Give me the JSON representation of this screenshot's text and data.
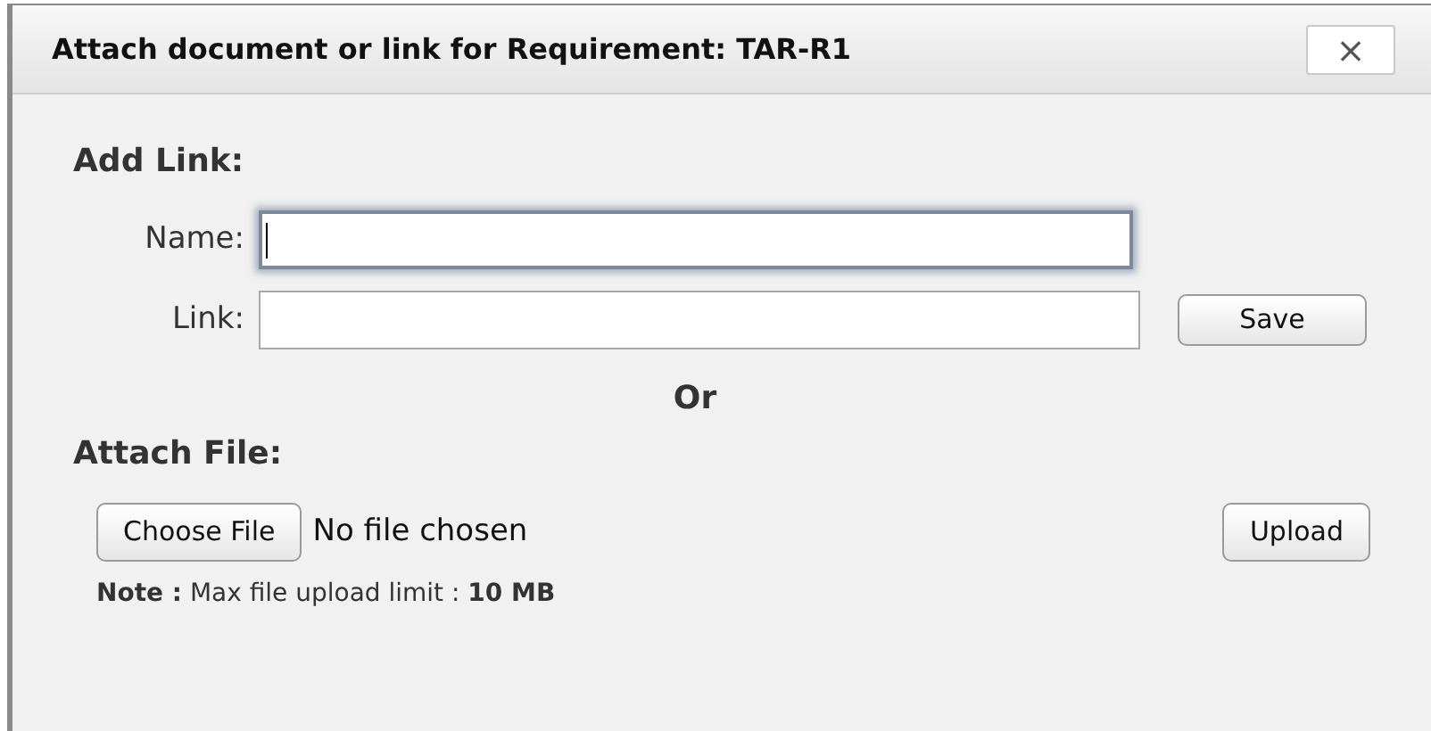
{
  "dialog": {
    "title": "Attach document or link for Requirement: TAR-R1",
    "close_label": "×"
  },
  "add_link": {
    "heading": "Add Link:",
    "fields": [
      {
        "label": "Name:",
        "focused": true
      },
      {
        "label": "Link:",
        "focused": false
      }
    ],
    "save_button": "Save"
  },
  "separator": "Or",
  "attach_file": {
    "heading": "Attach File:",
    "choose_button": "Choose File",
    "file_status": "No file chosen",
    "upload_button": "Upload",
    "note": "**Note :** Max file upload limit : **10 MB**"
  }
}
